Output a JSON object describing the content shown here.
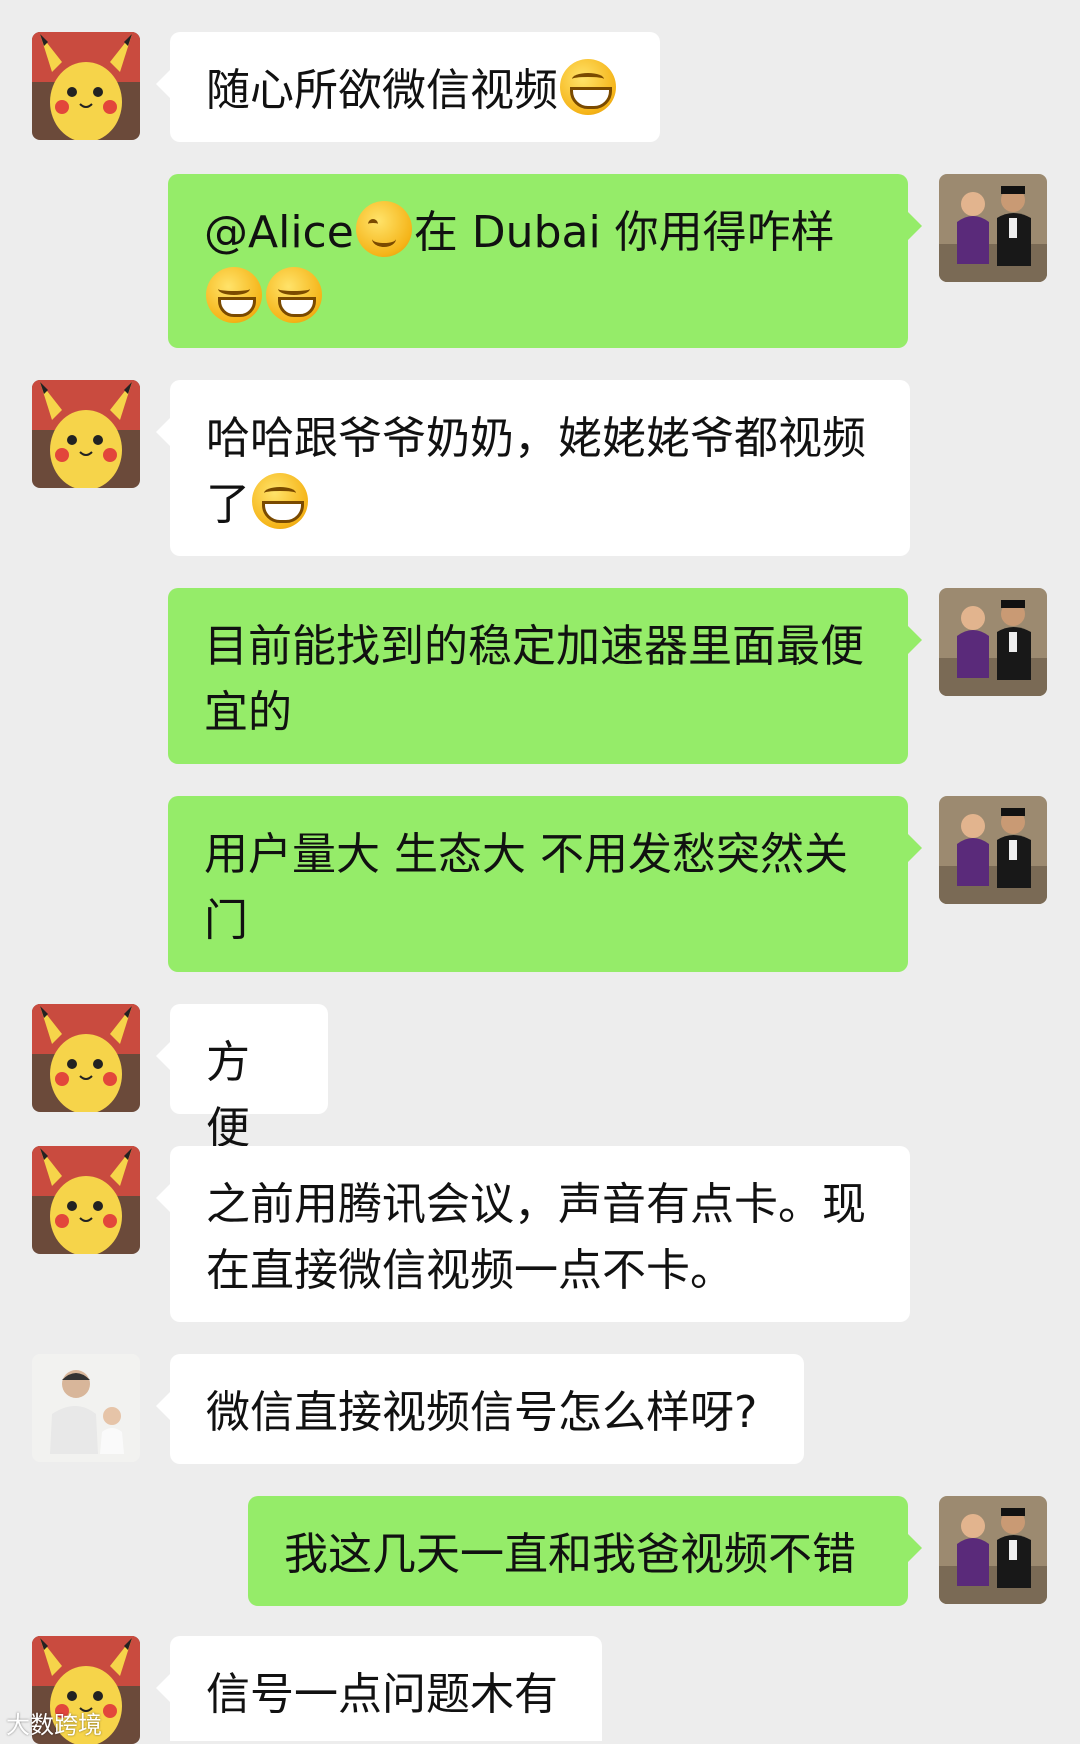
{
  "colors": {
    "background": "#ededed",
    "bubble_self": "#95ec69",
    "bubble_other": "#ffffff",
    "text": "#111111"
  },
  "messages": [
    {
      "sender": "other",
      "avatar": "pikachu-avatar",
      "text": "随心所欲微信视频",
      "emoji_after": "grin"
    },
    {
      "sender": "self",
      "avatar": "couple-avatar",
      "text": "@Alice",
      "emoji_mid": "smile",
      "text2": "在 Dubai  你用得咋样",
      "emoji_after": "smirk",
      "emoji_after2": "smirk"
    },
    {
      "sender": "other",
      "avatar": "pikachu-avatar",
      "text": "哈哈跟爷爷奶奶，姥姥姥爷都视频了",
      "emoji_after": "grin"
    },
    {
      "sender": "self",
      "avatar": "couple-avatar",
      "text": "目前能找到的稳定加速器里面最便宜的"
    },
    {
      "sender": "self",
      "avatar": "couple-avatar",
      "text": "用户量大 生态大 不用发愁突然关门"
    },
    {
      "sender": "other",
      "avatar": "pikachu-avatar",
      "text": "方便"
    },
    {
      "sender": "other",
      "avatar": "pikachu-avatar",
      "text": "之前用腾讯会议，声音有点卡。现在直接微信视频一点不卡。"
    },
    {
      "sender": "other",
      "avatar": "father-child-avatar",
      "text": "微信直接视频信号怎么样呀?"
    },
    {
      "sender": "self",
      "avatar": "couple-avatar",
      "text": "我这几天一直和我爸视频不错"
    },
    {
      "sender": "other",
      "avatar": "pikachu-avatar",
      "text": "信号一点问题木有"
    }
  ],
  "watermark": "大数跨境"
}
